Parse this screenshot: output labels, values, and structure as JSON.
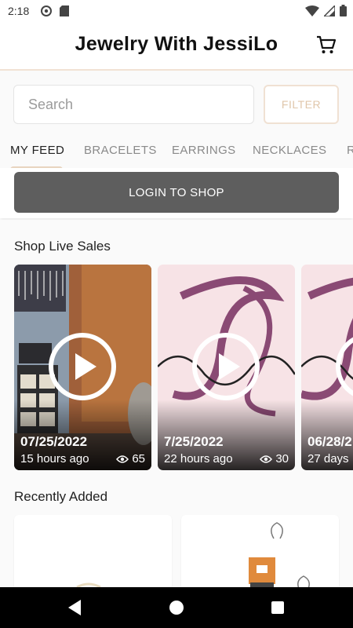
{
  "status": {
    "time": "2:18"
  },
  "header": {
    "title": "Jewelry With JessiLo"
  },
  "search": {
    "placeholder": "Search",
    "filter_label": "FILTER"
  },
  "tabs": [
    {
      "label": "MY FEED"
    },
    {
      "label": "BRACELETS"
    },
    {
      "label": "EARRINGS"
    },
    {
      "label": "NECKLACES"
    },
    {
      "label": "R"
    }
  ],
  "login_label": "LOGIN TO SHOP",
  "live_sales": {
    "title": "Shop Live Sales",
    "items": [
      {
        "date": "07/25/2022",
        "ago": "15 hours ago",
        "views": "65"
      },
      {
        "date": "7/25/2022",
        "ago": "22 hours ago",
        "views": "30"
      },
      {
        "date": "06/28/2",
        "ago": "27 days",
        "views": ""
      }
    ]
  },
  "recently_added": {
    "title": "Recently Added"
  },
  "colors": {
    "accent": "#e8d4bf",
    "login_bg": "#5e5e5e",
    "filter_text": "#e0c6aa"
  }
}
